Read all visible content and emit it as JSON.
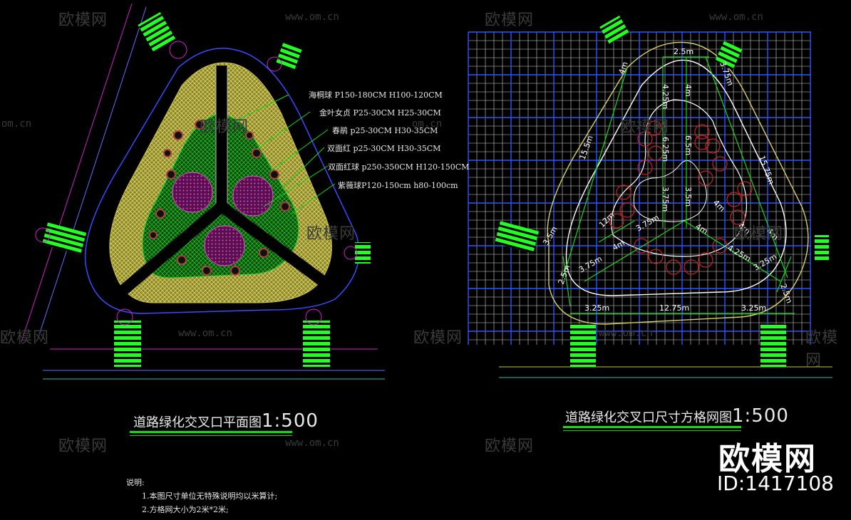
{
  "watermarks": {
    "brand": "欧模网",
    "url": "www.om.cn",
    "url_fragment": "om.cn"
  },
  "left_plan": {
    "title_main": "道路绿化交叉口平面图",
    "title_scale": "1:500",
    "legend": [
      "海桐球 P150-180CM H100-120CM",
      "金叶女贞 P25-30CM H25-30CM",
      "春鹃 p25-30CM H30-35CM",
      "双面红 p25-30CM H30-35CM",
      "双面红球 p250-350CM H120-150CM",
      "紫薇球P120-150cm h80-100cm"
    ]
  },
  "right_plan": {
    "title_main": "道路绿化交叉口尺寸方格网图",
    "title_scale": "1:500",
    "dimensions": [
      "2.5m",
      "4m",
      "4.25m",
      "4m",
      "3.75m",
      "6.25m",
      "6.5m",
      "15.5m",
      "15.75m",
      "3.75m",
      "3.5m",
      "12m",
      "3.75m",
      "4m",
      "4m",
      "4m",
      "4m",
      "3.5m",
      "2.5m",
      "3.75m",
      "4.25m",
      "3.25m",
      "4m",
      "2.5m",
      "3.25m",
      "12.75m",
      "3.25m"
    ]
  },
  "notes": {
    "heading": "说明:",
    "items": [
      "1.本图尺寸单位无特殊说明均以米算计;",
      "2.方格网大小为2米*2米;"
    ]
  },
  "brand_badge": {
    "name": "欧模网",
    "id": "ID:1417108"
  },
  "colors": {
    "background": "#000000",
    "grid_blue": "#2f55ff",
    "grid_white": "#d8d8d8",
    "dimension_green": "#16d916",
    "hedge_yellow": "#c8c24a",
    "shrub_green": "#1f8f1f",
    "flower_magenta": "#b0309a",
    "road_magenta": "#d020d0",
    "accent_green": "#22ff22"
  }
}
